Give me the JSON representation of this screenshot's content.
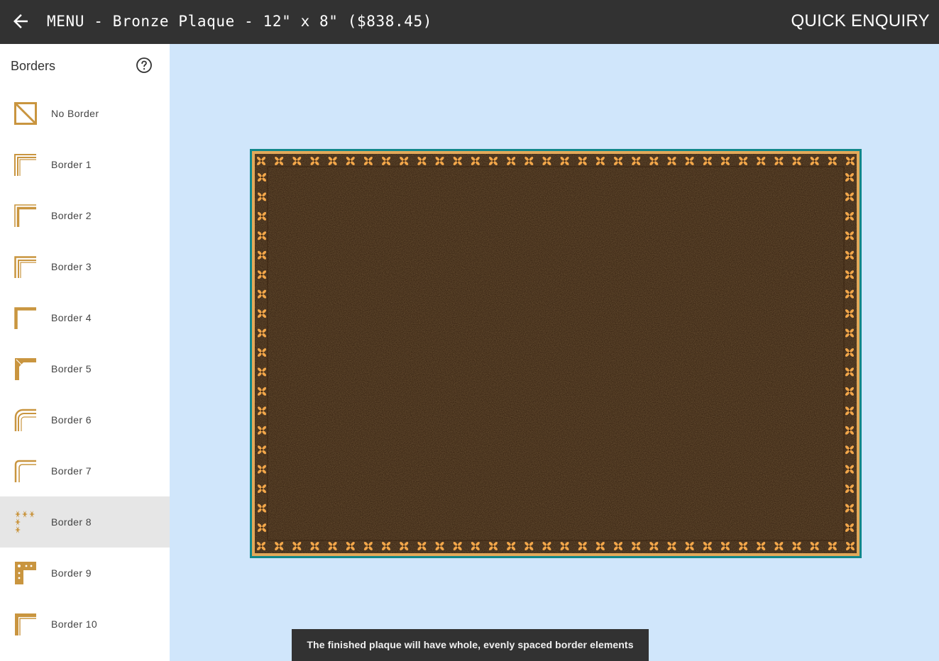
{
  "header": {
    "title": "MENU - Bronze Plaque - 12\" x 8\" ($838.45)",
    "quick_enquiry": "QUICK ENQUIRY",
    "back_icon": "arrow-left-icon"
  },
  "sidebar": {
    "title": "Borders",
    "help_icon": "help-circle-icon",
    "items": [
      {
        "label": "No Border",
        "icon": "no-border-icon"
      },
      {
        "label": "Border 1",
        "icon": "border-1-icon"
      },
      {
        "label": "Border 2",
        "icon": "border-2-icon"
      },
      {
        "label": "Border 3",
        "icon": "border-3-icon"
      },
      {
        "label": "Border 4",
        "icon": "border-4-icon"
      },
      {
        "label": "Border 5",
        "icon": "border-5-icon"
      },
      {
        "label": "Border 6",
        "icon": "border-6-icon"
      },
      {
        "label": "Border 7",
        "icon": "border-7-icon"
      },
      {
        "label": "Border 8",
        "icon": "border-8-icon",
        "selected": true
      },
      {
        "label": "Border 9",
        "icon": "border-9-icon"
      },
      {
        "label": "Border 10",
        "icon": "border-10-icon"
      }
    ]
  },
  "canvas": {
    "background_color": "#d0e6fb",
    "plaque_color": "#2e1b0c",
    "border_ornament_color": "#f3a74a",
    "selection_outline_color": "#11878a"
  },
  "toast": {
    "message": "The finished plaque will have whole, evenly spaced border elements"
  },
  "colors": {
    "topbar": "#323232",
    "accent_gold": "#c9953f"
  }
}
